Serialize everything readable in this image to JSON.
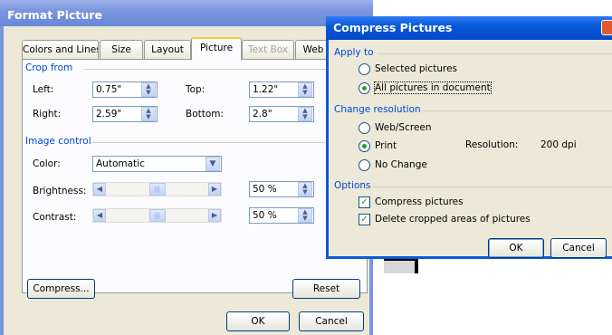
{
  "format_picture": {
    "title": "Format Picture",
    "tabs": [
      "Colors and Lines",
      "Size",
      "Layout",
      "Picture",
      "Text Box",
      "Web"
    ],
    "crop_from": {
      "group_label": "Crop from",
      "left_label": "Left:",
      "left_value": "0.75\"",
      "right_label": "Right:",
      "right_value": "2.59\"",
      "top_label": "Top:",
      "top_value": "1.22\"",
      "bottom_label": "Bottom:",
      "bottom_value": "2.8\""
    },
    "image_control": {
      "group_label": "Image control",
      "color_label": "Color:",
      "color_value": "Automatic",
      "brightness_label": "Brightness:",
      "brightness_value": "50 %",
      "contrast_label": "Contrast:",
      "contrast_value": "50 %",
      "brightness_level": 0.5,
      "contrast_level": 0.5
    },
    "compress_button": "Compress...",
    "reset_button": "Reset",
    "ok_button": "OK",
    "cancel_button": "Cancel"
  },
  "compress_pictures": {
    "title": "Compress Pictures",
    "apply_to": {
      "group_label": "Apply to",
      "selected_pictures": "Selected pictures",
      "all_pictures": "All pictures in document",
      "selected": "all_pictures"
    },
    "change_resolution": {
      "group_label": "Change resolution",
      "web_screen": "Web/Screen",
      "print": "Print",
      "no_change": "No Change",
      "selected": "print",
      "resolution_label": "Resolution:",
      "resolution_value": "200 dpi"
    },
    "options": {
      "group_label": "Options",
      "compress_pictures": "Compress pictures",
      "compress_checked": true,
      "delete_cropped": "Delete cropped areas of pictures",
      "delete_checked": true
    },
    "ok_button": "OK",
    "cancel_button": "Cancel"
  },
  "colors": {
    "title_bar_inactive": "#7b96de",
    "title_bar_active": "#0a5ad8",
    "dialog_face": "#ece9d8",
    "group_label": "#0046d5"
  }
}
